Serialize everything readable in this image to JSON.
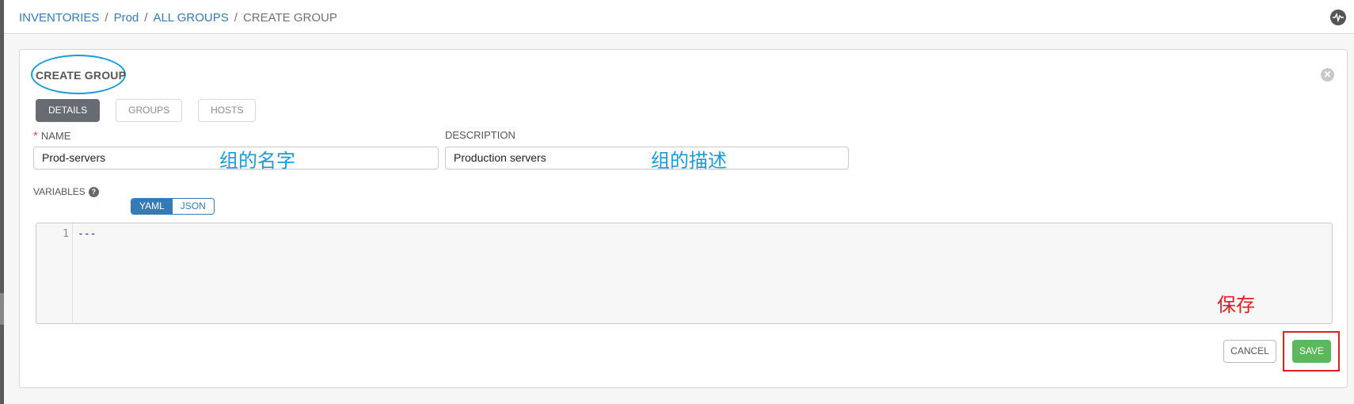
{
  "breadcrumb": {
    "items": [
      "INVENTORIES",
      "Prod",
      "ALL GROUPS",
      "CREATE GROUP"
    ],
    "separator": "/"
  },
  "header": {
    "activity_icon": "activity-stream-icon"
  },
  "panel": {
    "title": "CREATE GROUP",
    "close_glyph": "✕",
    "tabs": [
      "DETAILS",
      "GROUPS",
      "HOSTS"
    ],
    "active_tab": "DETAILS"
  },
  "form": {
    "name_label": "NAME",
    "required_mark": "*",
    "name_value": "Prod-servers",
    "description_label": "DESCRIPTION",
    "description_value": "Production servers",
    "variables_label": "VARIABLES",
    "help_glyph": "?",
    "format_options": [
      "YAML",
      "JSON"
    ],
    "selected_format": "YAML",
    "editor": {
      "line_number": "1",
      "content": "---"
    }
  },
  "actions": {
    "cancel_label": "CANCEL",
    "save_label": "SAVE"
  },
  "annotations": {
    "name_note": "组的名字",
    "description_note": "组的描述",
    "save_note": "保存"
  },
  "colors": {
    "link": "#337ab7",
    "save_green": "#5cb85c",
    "annotation_blue": "#1a9ad9",
    "annotation_red": "#e02020",
    "active_tab": "#676b72"
  }
}
